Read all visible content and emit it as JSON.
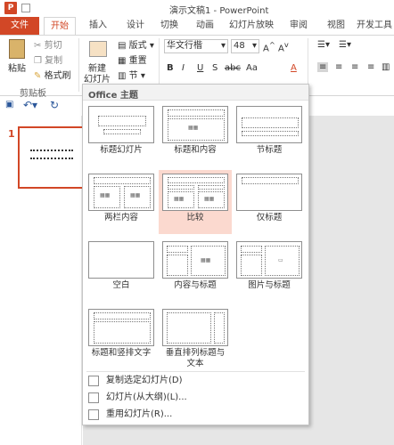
{
  "app": {
    "icon_letter": "P",
    "title": "演示文稿1 - PowerPoint"
  },
  "tabs": [
    "文件",
    "开始",
    "插入",
    "设计",
    "切换",
    "动画",
    "幻灯片放映",
    "审阅",
    "视图",
    "开发工具"
  ],
  "ribbon": {
    "clipboard": {
      "paste_label": "粘贴",
      "cut_label": "剪切",
      "copy_label": "复制",
      "format_painter_label": "格式刷",
      "group_label": "剪贴板"
    },
    "slides": {
      "new_slide_label_1": "新建",
      "new_slide_label_2": "幻灯片",
      "layout_label": "版式",
      "reset_label": "重置",
      "section_label": "节"
    },
    "font": {
      "font_name": "华文行楷",
      "font_size": "48",
      "bold": "B",
      "italic": "I",
      "underline": "U",
      "strike": "S",
      "spacing": "abc",
      "case": "Aa",
      "font_color": "A"
    }
  },
  "dropdown": {
    "header": "Office 主题",
    "layouts": [
      {
        "label": "标题幻灯片",
        "selected": false
      },
      {
        "label": "标题和内容",
        "selected": false
      },
      {
        "label": "节标题",
        "selected": false
      },
      {
        "label": "两栏内容",
        "selected": false
      },
      {
        "label": "比较",
        "selected": true
      },
      {
        "label": "仅标题",
        "selected": false
      },
      {
        "label": "空白",
        "selected": false
      },
      {
        "label": "内容与标题",
        "selected": false
      },
      {
        "label": "图片与标题",
        "selected": false
      },
      {
        "label": "标题和竖排文字",
        "selected": false
      },
      {
        "label": "垂直排列标题与文本",
        "selected": false
      }
    ],
    "menu_items": [
      {
        "label": "复制选定幻灯片(D)"
      },
      {
        "label": "幻灯片(从大纲)(L)..."
      },
      {
        "label": "重用幻灯片(R)..."
      }
    ]
  },
  "thumbnail": {
    "number": "1"
  },
  "colors": {
    "accent": "#d24726",
    "selected_bg": "#fbd9cf"
  }
}
